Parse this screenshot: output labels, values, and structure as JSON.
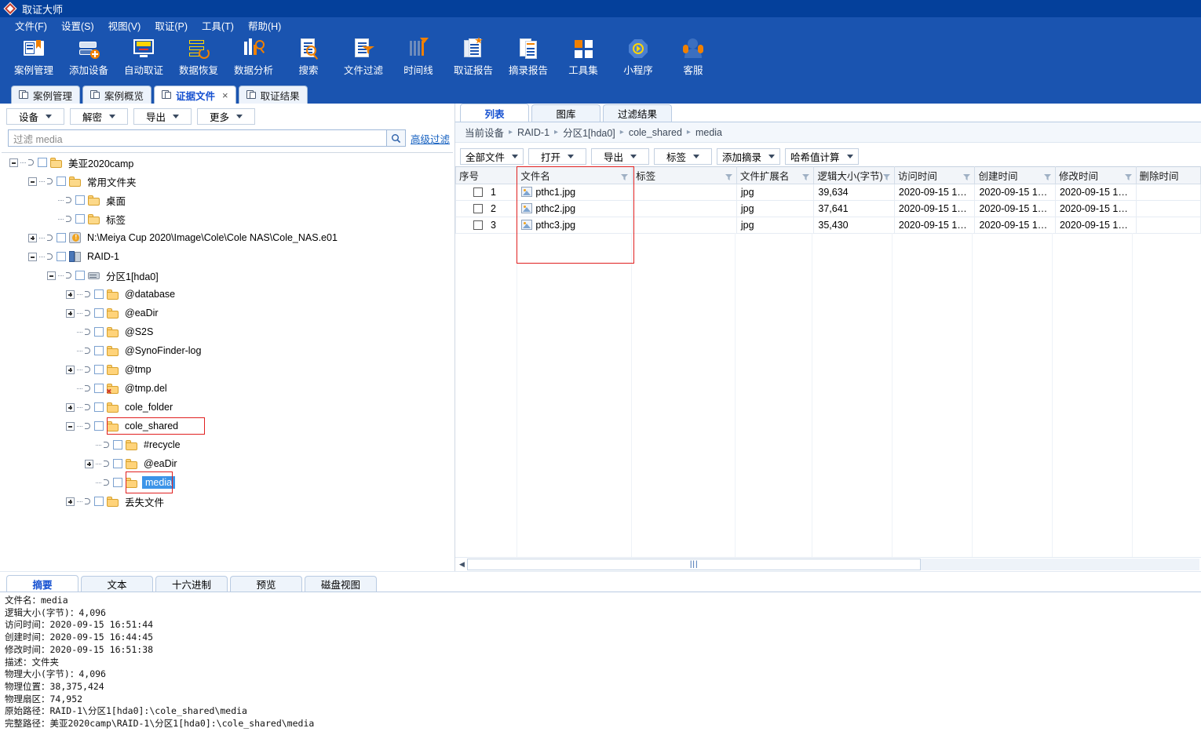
{
  "window": {
    "title": "取证大师",
    "logo_icon": "diamond-logo-icon"
  },
  "menubar": [
    {
      "label": "文件(F)"
    },
    {
      "label": "设置(S)"
    },
    {
      "label": "视图(V)"
    },
    {
      "label": "取证(P)"
    },
    {
      "label": "工具(T)"
    },
    {
      "label": "帮助(H)"
    }
  ],
  "toolbar": [
    {
      "label": "案例管理",
      "icon": "case-management-icon"
    },
    {
      "label": "添加设备",
      "icon": "add-device-icon"
    },
    {
      "label": "自动取证",
      "icon": "auto-forensics-icon"
    },
    {
      "label": "数据恢复",
      "icon": "data-recovery-icon"
    },
    {
      "label": "数据分析",
      "icon": "data-analysis-icon"
    },
    {
      "label": "搜索",
      "icon": "search-icon"
    },
    {
      "label": "文件过滤",
      "icon": "file-filter-icon"
    },
    {
      "label": "时间线",
      "icon": "timeline-icon"
    },
    {
      "label": "取证报告",
      "icon": "forensics-report-icon"
    },
    {
      "label": "摘录报告",
      "icon": "excerpt-report-icon"
    },
    {
      "label": "工具集",
      "icon": "toolset-icon"
    },
    {
      "label": "小程序",
      "icon": "mini-program-icon"
    },
    {
      "label": "客服",
      "icon": "customer-service-icon"
    }
  ],
  "main_tabs": [
    {
      "label": "案例管理",
      "active": false,
      "closable": false
    },
    {
      "label": "案例概览",
      "active": false,
      "closable": false
    },
    {
      "label": "证据文件",
      "active": true,
      "closable": true,
      "close_label": "×"
    },
    {
      "label": "取证结果",
      "active": false,
      "closable": false
    }
  ],
  "left_panel": {
    "dropdowns": [
      {
        "label": "设备"
      },
      {
        "label": "解密"
      },
      {
        "label": "导出"
      },
      {
        "label": "更多"
      }
    ],
    "filter": {
      "placeholder": "过滤 media",
      "value": "",
      "search_icon": "magnifier-icon",
      "advanced_link": "高级过滤"
    },
    "tree": [
      {
        "label": "美亚2020camp",
        "depth": 0,
        "expander": "minus",
        "icon": "folder-open-icon",
        "checked": false,
        "highlight": false,
        "box": false
      },
      {
        "label": "常用文件夹",
        "depth": 1,
        "expander": "minus",
        "icon": "folder-open-icon",
        "checked": false,
        "highlight": false,
        "box": false
      },
      {
        "label": "桌面",
        "depth": 2,
        "expander": "none",
        "icon": "folder-open-icon",
        "checked": false,
        "highlight": false,
        "box": false
      },
      {
        "label": "标签",
        "depth": 2,
        "expander": "none",
        "icon": "folder-open-icon",
        "checked": false,
        "highlight": false,
        "box": false
      },
      {
        "label": "N:\\Meiya Cup 2020\\Image\\Cole\\Cole NAS\\Cole_NAS.e01",
        "depth": 1,
        "expander": "plus",
        "icon": "disk-image-warning-icon",
        "checked": false,
        "highlight": false,
        "box": false
      },
      {
        "label": "RAID-1",
        "depth": 1,
        "expander": "minus",
        "icon": "raid-device-icon",
        "checked": false,
        "highlight": false,
        "box": false
      },
      {
        "label": "分区1[hda0]",
        "depth": 2,
        "expander": "minus",
        "icon": "partition-icon",
        "checked": false,
        "highlight": false,
        "box": false
      },
      {
        "label": "@database",
        "depth": 3,
        "expander": "plus",
        "icon": "folder-icon",
        "checked": false,
        "highlight": false,
        "box": false
      },
      {
        "label": "@eaDir",
        "depth": 3,
        "expander": "plus",
        "icon": "folder-icon",
        "checked": false,
        "highlight": false,
        "box": false
      },
      {
        "label": "@S2S",
        "depth": 3,
        "expander": "none",
        "icon": "folder-icon",
        "checked": false,
        "highlight": false,
        "box": false
      },
      {
        "label": "@SynoFinder-log",
        "depth": 3,
        "expander": "none",
        "icon": "folder-icon",
        "checked": false,
        "highlight": false,
        "box": false
      },
      {
        "label": "@tmp",
        "depth": 3,
        "expander": "plus",
        "icon": "folder-icon",
        "checked": false,
        "highlight": false,
        "box": false
      },
      {
        "label": "@tmp.del",
        "depth": 3,
        "expander": "none",
        "icon": "folder-deleted-icon",
        "checked": false,
        "highlight": false,
        "box": false
      },
      {
        "label": "cole_folder",
        "depth": 3,
        "expander": "plus",
        "icon": "folder-icon",
        "checked": false,
        "highlight": false,
        "box": false
      },
      {
        "label": "cole_shared",
        "depth": 3,
        "expander": "minus",
        "icon": "folder-icon",
        "checked": false,
        "highlight": false,
        "box": true
      },
      {
        "label": "#recycle",
        "depth": 4,
        "expander": "none",
        "icon": "folder-icon",
        "checked": false,
        "highlight": false,
        "box": false
      },
      {
        "label": "@eaDir",
        "depth": 4,
        "expander": "plus",
        "icon": "folder-icon",
        "checked": false,
        "highlight": false,
        "box": false
      },
      {
        "label": "media",
        "depth": 4,
        "expander": "none",
        "icon": "folder-icon",
        "checked": false,
        "highlight": true,
        "box": true
      },
      {
        "label": "丢失文件",
        "depth": 3,
        "expander": "plus",
        "icon": "folder-icon",
        "checked": false,
        "highlight": false,
        "box": false
      }
    ]
  },
  "right_panel": {
    "tabs": [
      {
        "label": "列表",
        "active": true
      },
      {
        "label": "图库",
        "active": false
      },
      {
        "label": "过滤结果",
        "active": false
      }
    ],
    "breadcrumb": [
      "当前设备",
      "RAID-1",
      "分区1[hda0]",
      "cole_shared",
      "media"
    ],
    "breadcrumb_separator": "▸",
    "dropdowns": [
      {
        "label": "全部文件"
      },
      {
        "label": "打开"
      },
      {
        "label": "导出"
      },
      {
        "label": "标签"
      },
      {
        "label": "添加摘录"
      },
      {
        "label": "哈希值计算"
      }
    ],
    "table": {
      "columns": [
        {
          "label": "序号",
          "filter": false
        },
        {
          "label": "文件名",
          "filter": true
        },
        {
          "label": "标签",
          "filter": true
        },
        {
          "label": "文件扩展名",
          "filter": true
        },
        {
          "label": "逻辑大小(字节)",
          "filter": true
        },
        {
          "label": "访问时间",
          "filter": true
        },
        {
          "label": "创建时间",
          "filter": true
        },
        {
          "label": "修改时间",
          "filter": true
        },
        {
          "label": "删除时间",
          "filter": false
        }
      ],
      "rows": [
        {
          "index": "1",
          "name": "pthc1.jpg",
          "icon": "image-file-icon",
          "tag": "",
          "ext": "jpg",
          "size": "39,634",
          "accessed": "2020-09-15 1…",
          "created": "2020-09-15 1…",
          "modified": "2020-09-15 1…",
          "deleted": ""
        },
        {
          "index": "2",
          "name": "pthc2.jpg",
          "icon": "image-file-icon",
          "tag": "",
          "ext": "jpg",
          "size": "37,641",
          "accessed": "2020-09-15 1…",
          "created": "2020-09-15 1…",
          "modified": "2020-09-15 1…",
          "deleted": ""
        },
        {
          "index": "3",
          "name": "pthc3.jpg",
          "icon": "image-file-icon",
          "tag": "",
          "ext": "jpg",
          "size": "35,430",
          "accessed": "2020-09-15 1…",
          "created": "2020-09-15 1…",
          "modified": "2020-09-15 1…",
          "deleted": ""
        }
      ]
    },
    "scrollbar": {
      "grip": "|||",
      "left_arrow": "◀"
    }
  },
  "bottom_panel": {
    "tabs": [
      {
        "label": "摘要",
        "active": true
      },
      {
        "label": "文本",
        "active": false
      },
      {
        "label": "十六进制",
        "active": false
      },
      {
        "label": "预览",
        "active": false
      },
      {
        "label": "磁盘视图",
        "active": false
      }
    ],
    "details": [
      "文件名：media",
      "逻辑大小(字节)：4,096",
      "访问时间：2020-09-15 16:51:44",
      "创建时间：2020-09-15 16:44:45",
      "修改时间：2020-09-15 16:51:38",
      "描述：文件夹",
      "物理大小(字节)：4,096",
      "物理位置：38,375,424",
      "物理扇区：74,952",
      "原始路径：RAID-1\\分区1[hda0]:\\cole_shared\\media",
      "完整路径：美亚2020camp\\RAID-1\\分区1[hda0]:\\cole_shared\\media"
    ]
  },
  "colors": {
    "title_blue": "#04409b",
    "chrome_blue": "#1a54b0",
    "accent_orange": "#f08000",
    "active_tab_text": "#1550d0",
    "selection_blue": "#3c94e8",
    "annotation_red": "#e02020"
  }
}
